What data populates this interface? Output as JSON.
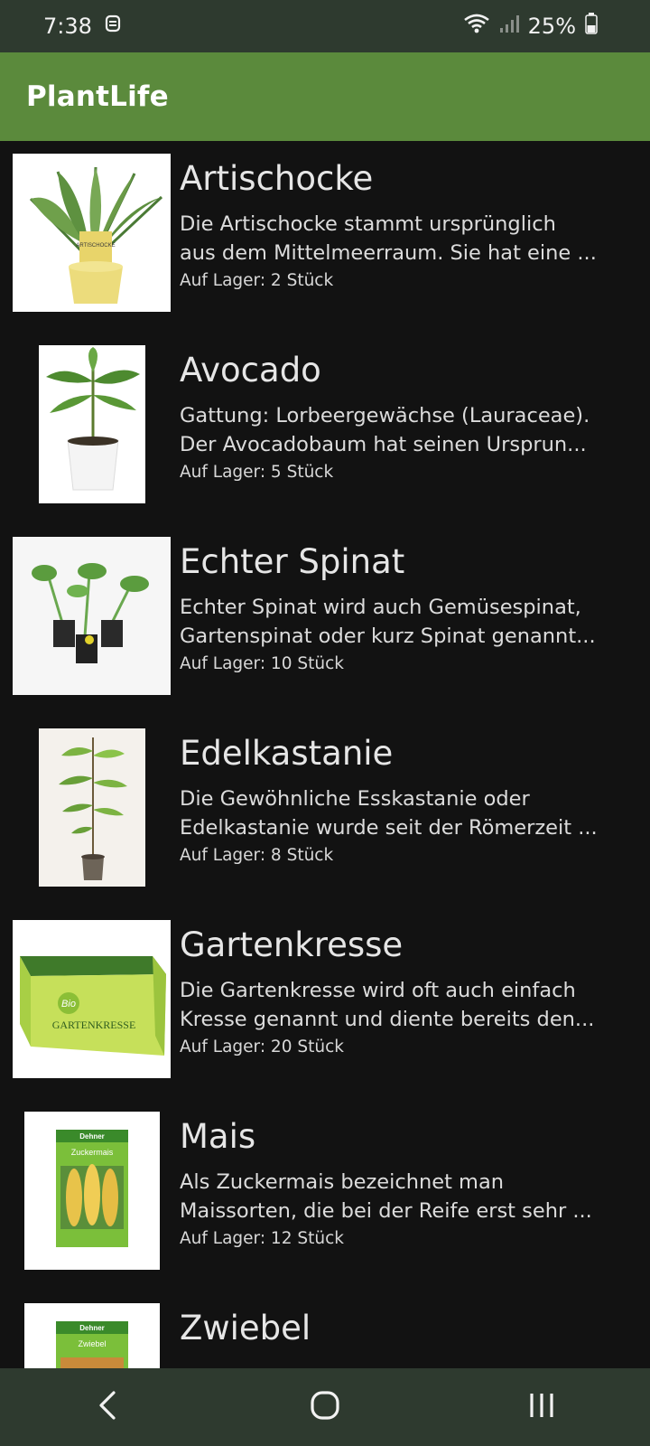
{
  "status_bar": {
    "time": "7:38",
    "battery": "25%",
    "icons": [
      "notification-icon",
      "wifi-icon",
      "signal-icon",
      "battery-icon"
    ]
  },
  "app_bar": {
    "title": "PlantLife",
    "color": "#5b8a3c"
  },
  "plants": [
    {
      "name": "Artischocke",
      "desc_line1": "Die Artischocke stammt ursprünglich",
      "desc_line2": "aus dem Mittelmeerraum. Sie hat eine ...",
      "stock": "Auf Lager: 2 Stück"
    },
    {
      "name": "Avocado",
      "desc_line1": "Gattung: Lorbeergewächse (Lauraceae).",
      "desc_line2": "Der Avocadobaum hat seinen Ursprun...",
      "stock": "Auf Lager: 5 Stück"
    },
    {
      "name": "Echter Spinat",
      "desc_line1": "Echter Spinat wird auch Gemüsespinat,",
      "desc_line2": "Gartenspinat oder kurz Spinat genannt...",
      "stock": "Auf Lager: 10 Stück"
    },
    {
      "name": "Edelkastanie",
      "desc_line1": "Die Gewöhnliche Esskastanie oder",
      "desc_line2": "Edelkastanie wurde seit der Römerzeit ...",
      "stock": "Auf Lager: 8 Stück"
    },
    {
      "name": "Gartenkresse",
      "desc_line1": "Die Gartenkresse wird oft auch einfach",
      "desc_line2": "Kresse genannt und diente bereits den...",
      "stock": "Auf Lager: 20 Stück"
    },
    {
      "name": "Mais",
      "desc_line1": "Als Zuckermais bezeichnet man",
      "desc_line2": "Maissorten, die bei der Reife erst sehr ...",
      "stock": "Auf Lager: 12 Stück"
    },
    {
      "name": "Zwiebel",
      "desc_line1": "",
      "desc_line2": "",
      "stock": ""
    }
  ],
  "image_labels": {
    "artischocke_tag": "ARTISCHOCKE",
    "kresse_bio": "Bio",
    "kresse_box": "GARTENKRESSE",
    "mais_brand": "Dehner",
    "mais_name": "Zuckermais",
    "zwiebel_brand": "Dehner",
    "zwiebel_name": "Zwiebel"
  },
  "nav_bar": {
    "icons": [
      "back-icon",
      "home-icon",
      "recents-icon"
    ]
  }
}
